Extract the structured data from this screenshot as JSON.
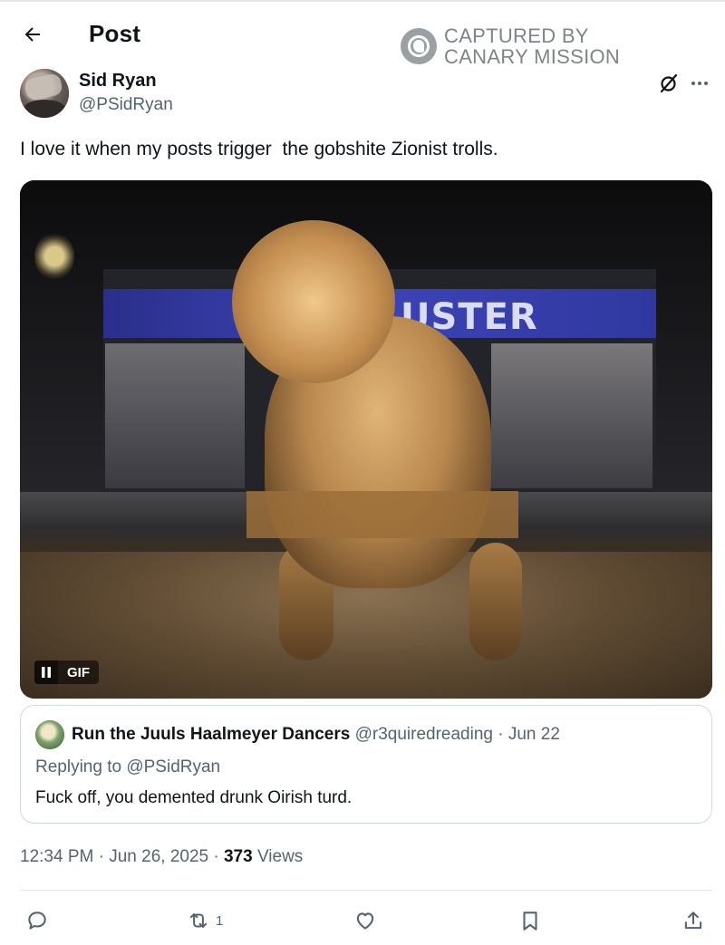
{
  "header": {
    "title": "Post",
    "back_icon": "arrow-left-icon"
  },
  "watermark": {
    "line1": "CAPTURED BY",
    "line2": "CANARY MISSION"
  },
  "post": {
    "author_name": "Sid Ryan",
    "author_handle": "@PSidRyan",
    "text": "I love it when my posts trigger  the gobshite Zionist trolls.",
    "media": {
      "type": "GIF",
      "badge_label": "GIF",
      "sign_text": "USTER"
    },
    "quoted": {
      "author_name": "Run the Juuls Haalmeyer Dancers",
      "author_handle": "@r3quiredreading",
      "separator": "·",
      "date": "Jun 22",
      "replying_to": "Replying to @PSidRyan",
      "text": "Fuck off, you demented drunk Oirish turd."
    },
    "time": "12:34 PM",
    "date": "Jun 26, 2025",
    "views_count": "373",
    "views_label": "Views"
  },
  "actions": {
    "reply_icon": "reply-icon",
    "repost_icon": "repost-icon",
    "repost_count": "1",
    "like_icon": "heart-icon",
    "bookmark_icon": "bookmark-icon",
    "share_icon": "share-icon"
  },
  "colors": {
    "text_primary": "#0f1419",
    "text_secondary": "#536471",
    "border": "#cfd9de"
  }
}
